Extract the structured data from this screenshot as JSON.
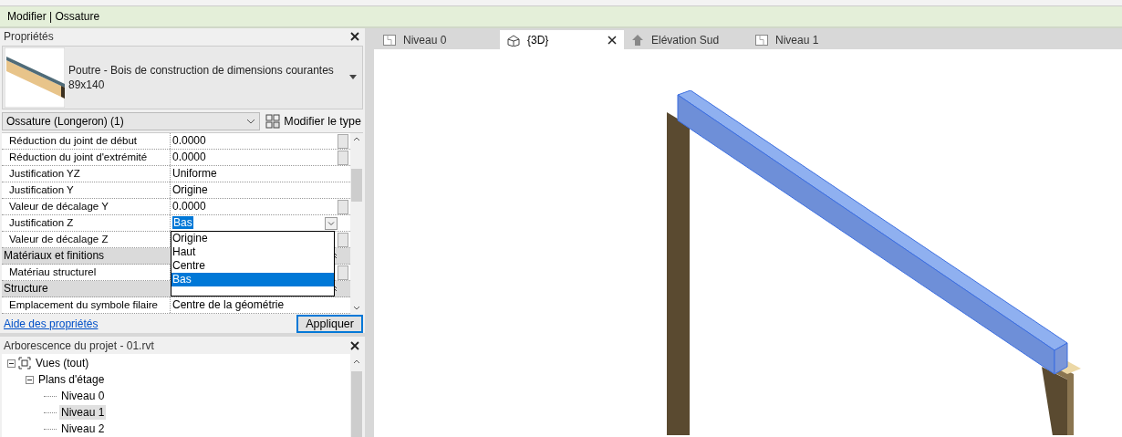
{
  "context_bar": {
    "title": "Modifier | Ossature"
  },
  "properties": {
    "title": "Propriétés",
    "type_name": "Poutre - Bois de construction de dimensions courantes",
    "type_size": "89x140",
    "filter": "Ossature (Longeron) (1)",
    "edit_type": "Modifier le type",
    "rows": [
      {
        "kind": "param",
        "label": "Réduction du joint de début",
        "value": "0.0000",
        "linkable": true
      },
      {
        "kind": "param",
        "label": "Réduction du joint d'extrémité",
        "value": "0.0000",
        "linkable": true
      },
      {
        "kind": "param",
        "label": "Justification YZ",
        "value": "Uniforme",
        "linkable": false
      },
      {
        "kind": "param",
        "label": "Justification Y",
        "value": "Origine",
        "linkable": false
      },
      {
        "kind": "param",
        "label": "Valeur de décalage Y",
        "value": "0.0000",
        "linkable": true
      },
      {
        "kind": "combo",
        "label": "Justification Z",
        "value": "Bas",
        "linkable": false,
        "options": [
          {
            "label": "Origine",
            "selected": false
          },
          {
            "label": "Haut",
            "selected": false
          },
          {
            "label": "Centre",
            "selected": false
          },
          {
            "label": "Bas",
            "selected": true
          }
        ]
      },
      {
        "kind": "param",
        "label": "Valeur de décalage Z",
        "value": "",
        "linkable": true
      },
      {
        "kind": "group",
        "label": "Matériaux et finitions"
      },
      {
        "kind": "param",
        "label": "Matériau structurel",
        "value": "",
        "linkable": true
      },
      {
        "kind": "group",
        "label": "Structure"
      },
      {
        "kind": "param",
        "label": "Emplacement du symbole filaire",
        "value": "Centre de la géométrie",
        "linkable": false
      }
    ],
    "help_link": "Aide des propriétés",
    "apply": "Appliquer"
  },
  "browser": {
    "title": "Arborescence du projet - 01.rvt",
    "tree": [
      {
        "label": "Vues (tout)",
        "expanded": true,
        "selected": false,
        "children": [
          {
            "label": "Plans d'étage",
            "expanded": true,
            "selected": false,
            "children": [
              {
                "label": "Niveau 0",
                "selected": false
              },
              {
                "label": "Niveau 1",
                "selected": true
              },
              {
                "label": "Niveau 2",
                "selected": false
              }
            ]
          }
        ]
      }
    ]
  },
  "tabs": [
    {
      "label": "Niveau 0",
      "kind": "plan",
      "selected": false
    },
    {
      "label": "{3D}",
      "kind": "perspective",
      "selected": true
    },
    {
      "label": "Elévation Sud",
      "kind": "elevation",
      "selected": false
    },
    {
      "label": "Niveau 1",
      "kind": "plan",
      "selected": false
    }
  ]
}
